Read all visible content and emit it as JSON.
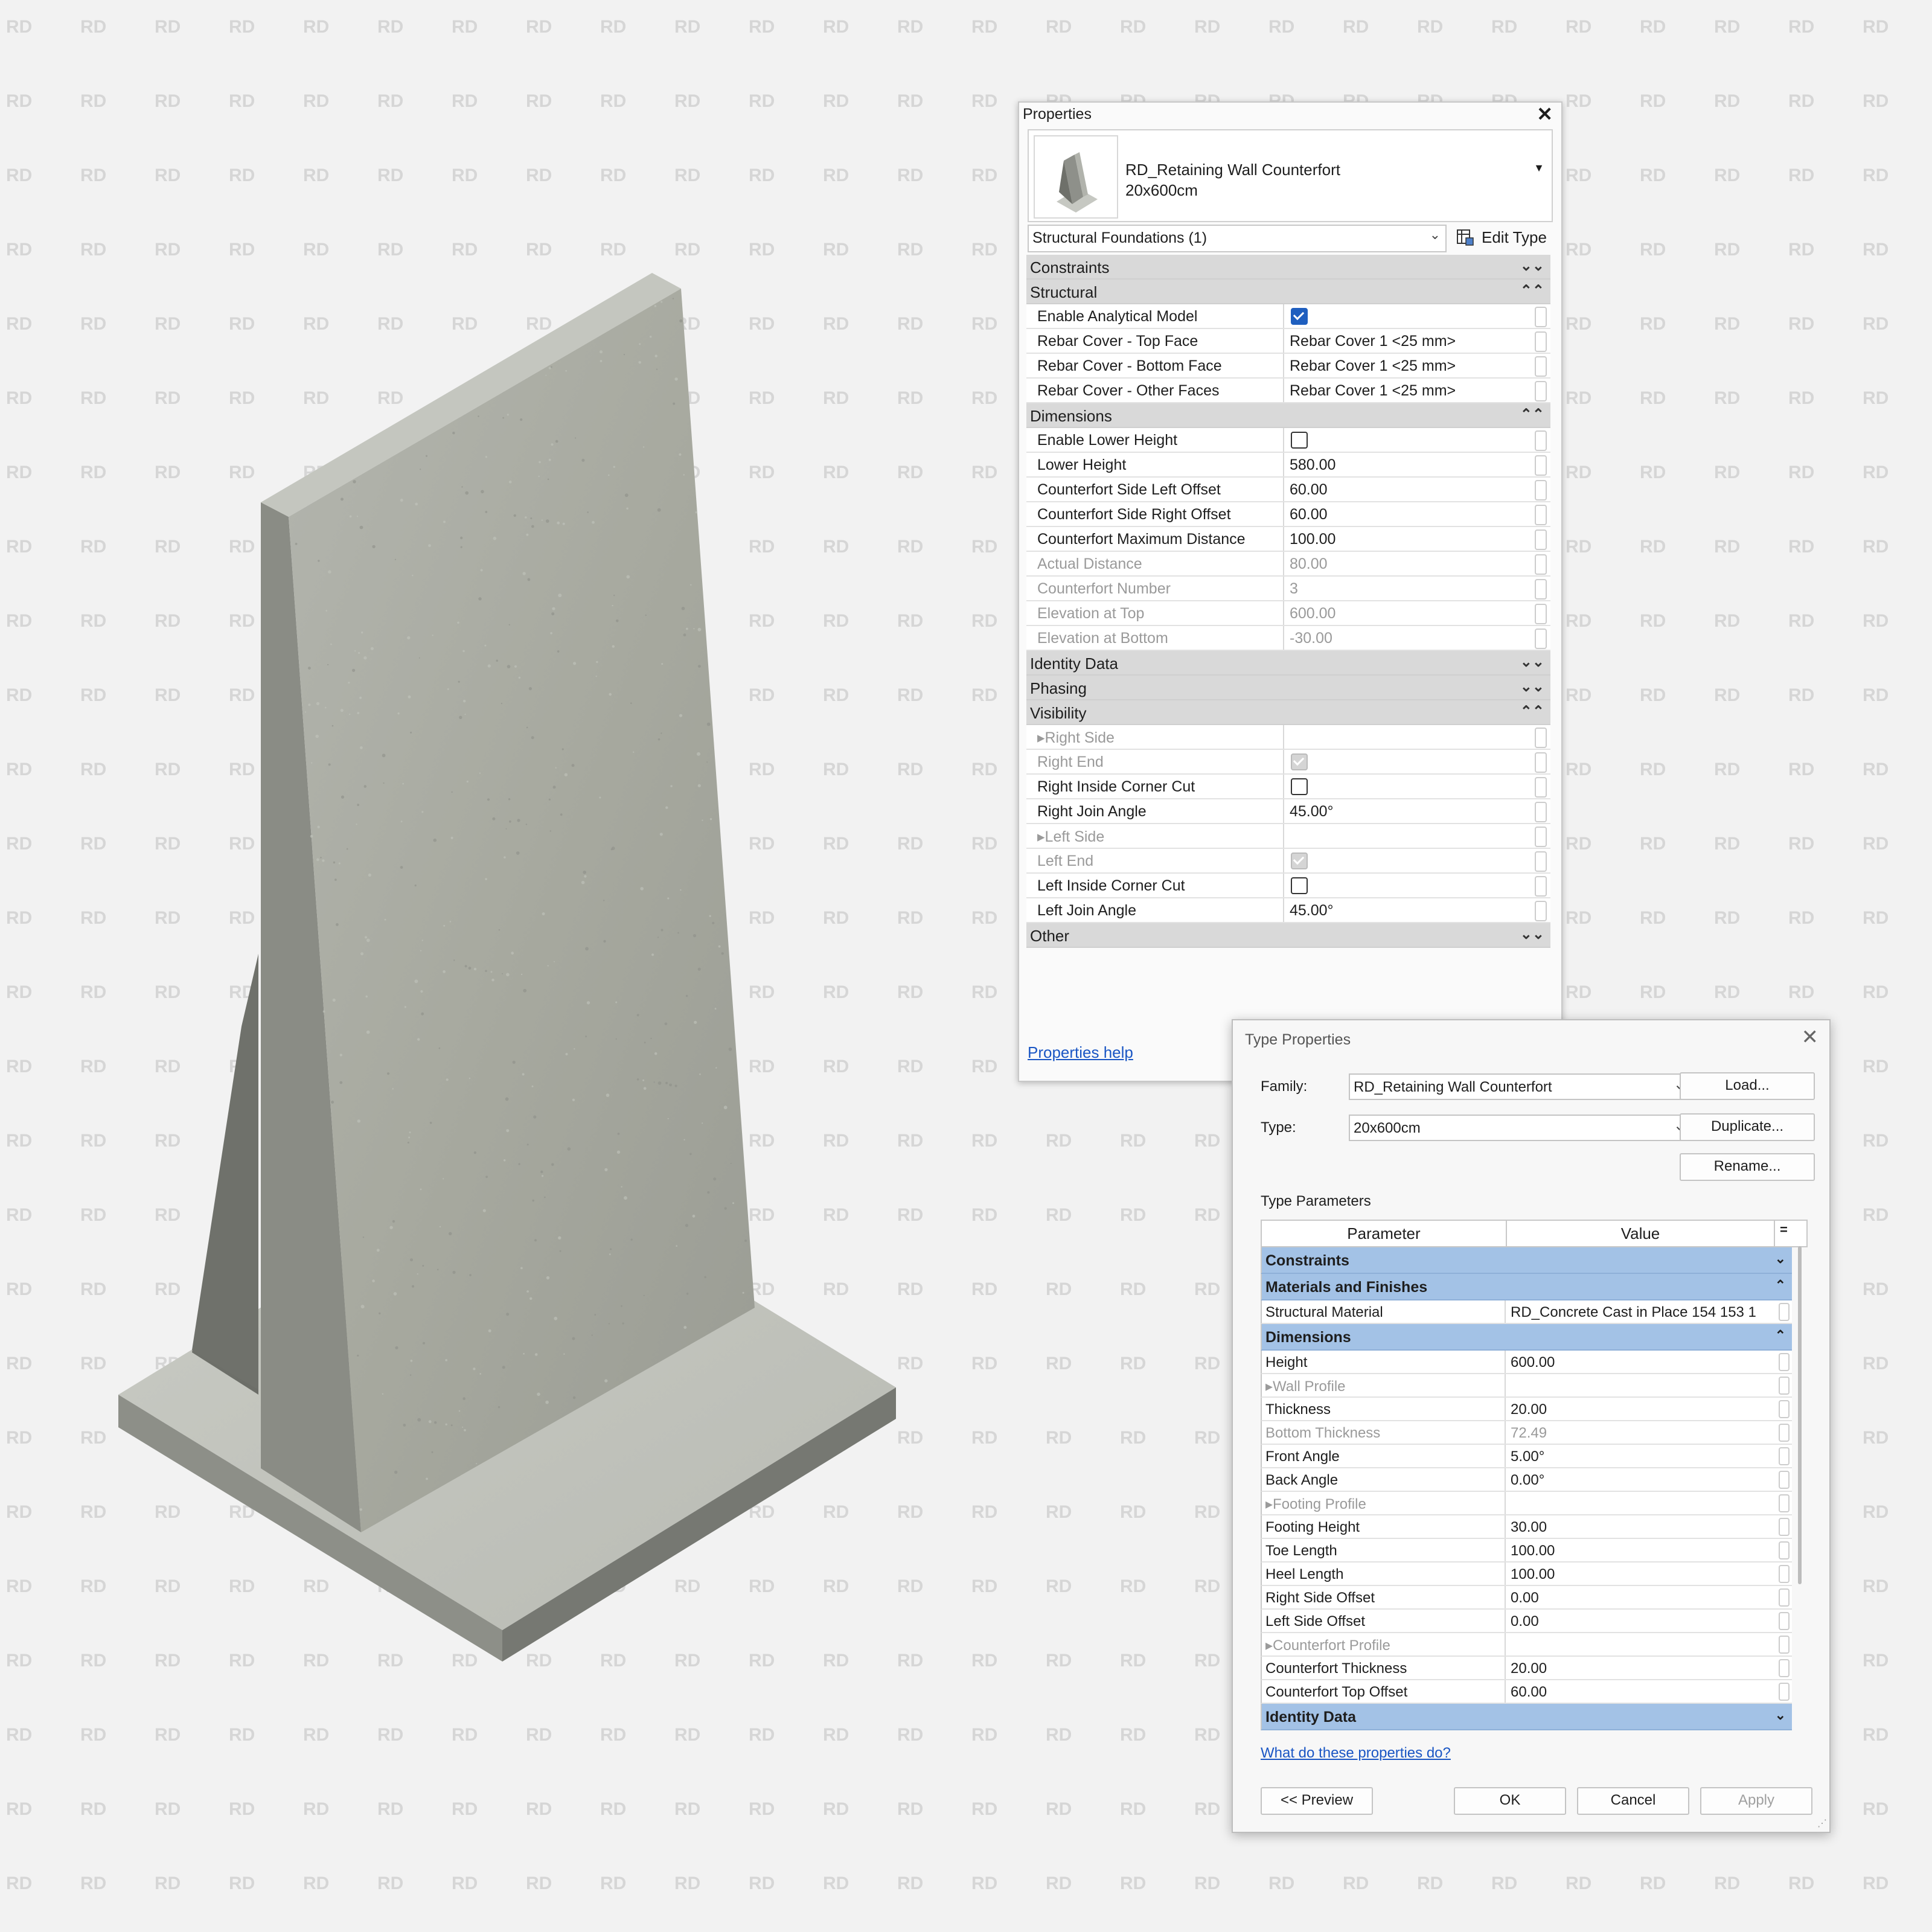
{
  "watermark": {
    "text": "RD",
    "color": "#d6d6d6"
  },
  "properties": {
    "title": "Properties",
    "type_name_line1": "RD_Retaining Wall Counterfort",
    "type_name_line2": "20x600cm",
    "filter": "Structural Foundations (1)",
    "edit_type_label": "Edit Type",
    "help_link": "Properties help",
    "rows": [
      {
        "kind": "cat",
        "label": "Constraints",
        "toggle": "⌄⌄"
      },
      {
        "kind": "cat",
        "label": "Structural",
        "toggle": "⌃⌃"
      },
      {
        "kind": "check",
        "label": "Enable Analytical Model",
        "checked": true,
        "dim": false
      },
      {
        "kind": "text",
        "label": "Rebar Cover - Top Face",
        "value": "Rebar Cover 1 <25 mm>"
      },
      {
        "kind": "text",
        "label": "Rebar Cover - Bottom Face",
        "value": "Rebar Cover 1 <25 mm>"
      },
      {
        "kind": "text",
        "label": "Rebar Cover - Other Faces",
        "value": "Rebar Cover 1 <25 mm>"
      },
      {
        "kind": "cat",
        "label": "Dimensions",
        "toggle": "⌃⌃"
      },
      {
        "kind": "check",
        "label": "Enable Lower Height",
        "checked": false,
        "dim": false
      },
      {
        "kind": "text",
        "label": "Lower Height",
        "value": "580.00"
      },
      {
        "kind": "text",
        "label": "Counterfort Side Left Offset",
        "value": "60.00"
      },
      {
        "kind": "text",
        "label": "Counterfort Side Right Offset",
        "value": "60.00"
      },
      {
        "kind": "text",
        "label": "Counterfort Maximum Distance",
        "value": "100.00"
      },
      {
        "kind": "text",
        "label": "Actual Distance",
        "value": "80.00",
        "dim": true
      },
      {
        "kind": "text",
        "label": "Counterfort Number",
        "value": "3",
        "dim": true
      },
      {
        "kind": "text",
        "label": "Elevation at Top",
        "value": "600.00",
        "dim": true
      },
      {
        "kind": "text",
        "label": "Elevation at Bottom",
        "value": "-30.00",
        "dim": true
      },
      {
        "kind": "cat",
        "label": "Identity Data",
        "toggle": "⌄⌄"
      },
      {
        "kind": "cat",
        "label": "Phasing",
        "toggle": "⌄⌄"
      },
      {
        "kind": "cat",
        "label": "Visibility",
        "toggle": "⌃⌃"
      },
      {
        "kind": "text",
        "label": "▸Right Side",
        "value": "",
        "dim": true
      },
      {
        "kind": "check",
        "label": "Right End",
        "checked": true,
        "dim": true
      },
      {
        "kind": "check",
        "label": "Right Inside Corner Cut",
        "checked": false,
        "dim": false
      },
      {
        "kind": "text",
        "label": "Right Join Angle",
        "value": "45.00°"
      },
      {
        "kind": "text",
        "label": "▸Left Side",
        "value": "",
        "dim": true
      },
      {
        "kind": "check",
        "label": "Left End",
        "checked": true,
        "dim": true
      },
      {
        "kind": "check",
        "label": "Left Inside Corner Cut",
        "checked": false,
        "dim": false
      },
      {
        "kind": "text",
        "label": "Left Join Angle",
        "value": "45.00°"
      },
      {
        "kind": "cat",
        "label": "Other",
        "toggle": "⌄⌄"
      }
    ]
  },
  "type_properties": {
    "title": "Type Properties",
    "family_label": "Family:",
    "family_value": "RD_Retaining Wall Counterfort",
    "type_label": "Type:",
    "type_value": "20x600cm",
    "load_btn": "Load...",
    "duplicate_btn": "Duplicate...",
    "rename_btn": "Rename...",
    "section_label": "Type Parameters",
    "col_parameter": "Parameter",
    "col_value": "Value",
    "col_eq": "=",
    "rows": [
      {
        "kind": "cat",
        "label": "Constraints",
        "toggle": "⌄"
      },
      {
        "kind": "cat",
        "label": "Materials and Finishes",
        "toggle": "⌃"
      },
      {
        "kind": "text",
        "label": "Structural Material",
        "value": "RD_Concrete Cast in Place 154 153 1"
      },
      {
        "kind": "cat",
        "label": "Dimensions",
        "toggle": "⌃"
      },
      {
        "kind": "text",
        "label": "Height",
        "value": "600.00"
      },
      {
        "kind": "text",
        "label": "▸Wall Profile",
        "value": "",
        "dim": true
      },
      {
        "kind": "text",
        "label": "Thickness",
        "value": "20.00"
      },
      {
        "kind": "text",
        "label": "Bottom Thickness",
        "value": "72.49",
        "dim": true
      },
      {
        "kind": "text",
        "label": "Front Angle",
        "value": "5.00°"
      },
      {
        "kind": "text",
        "label": "Back Angle",
        "value": "0.00°"
      },
      {
        "kind": "text",
        "label": "▸Footing Profile",
        "value": "",
        "dim": true
      },
      {
        "kind": "text",
        "label": "Footing Height",
        "value": "30.00"
      },
      {
        "kind": "text",
        "label": "Toe Length",
        "value": "100.00"
      },
      {
        "kind": "text",
        "label": "Heel Length",
        "value": "100.00"
      },
      {
        "kind": "text",
        "label": "Right Side Offset",
        "value": "0.00"
      },
      {
        "kind": "text",
        "label": "Left Side Offset",
        "value": "0.00"
      },
      {
        "kind": "text",
        "label": "▸Counterfort Profile",
        "value": "",
        "dim": true
      },
      {
        "kind": "text",
        "label": "Counterfort Thickness",
        "value": "20.00"
      },
      {
        "kind": "text",
        "label": "Counterfort Top Offset",
        "value": "60.00"
      },
      {
        "kind": "cat",
        "label": "Identity Data",
        "toggle": "⌄"
      }
    ],
    "help_link": "What do these properties do?",
    "preview_btn": "<< Preview",
    "ok_btn": "OK",
    "cancel_btn": "Cancel",
    "apply_btn": "Apply"
  },
  "colors": {
    "category_grey": "#d9d9d9",
    "category_blue": "#a3c2e6",
    "link": "#1a56c4",
    "checkbox_blue": "#1f5fbf",
    "concrete": "#a9aba4"
  }
}
